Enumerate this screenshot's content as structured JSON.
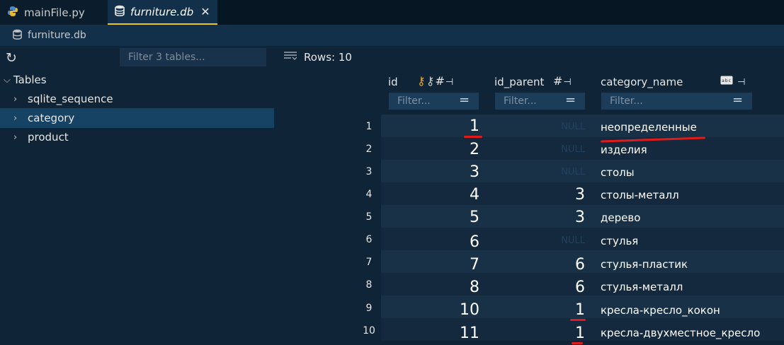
{
  "tabs": [
    {
      "label": "mainFile.py",
      "icon": "python-icon"
    },
    {
      "label": "furniture.db",
      "icon": "database-icon",
      "close": "✕"
    }
  ],
  "breadcrumb": {
    "label": "furniture.db",
    "icon": "database-icon"
  },
  "sidebar": {
    "filter_placeholder": "Filter 3 tables...",
    "root_label": "Tables",
    "items": [
      {
        "label": "sqlite_sequence"
      },
      {
        "label": "category"
      },
      {
        "label": "product"
      }
    ]
  },
  "grid": {
    "rows_label": "Rows: 10",
    "columns": [
      {
        "name": "id",
        "filter_placeholder": "Filter..."
      },
      {
        "name": "id_parent",
        "filter_placeholder": "Filter..."
      },
      {
        "name": "category_name",
        "filter_placeholder": "Filter..."
      }
    ],
    "rows": [
      {
        "num": "1",
        "id": "1",
        "parent": "NULL",
        "name": "неопределенные"
      },
      {
        "num": "2",
        "id": "2",
        "parent": "NULL",
        "name": "изделия"
      },
      {
        "num": "3",
        "id": "3",
        "parent": "NULL",
        "name": "столы"
      },
      {
        "num": "4",
        "id": "4",
        "parent": "3",
        "name": "столы-металл"
      },
      {
        "num": "5",
        "id": "5",
        "parent": "3",
        "name": "дерево"
      },
      {
        "num": "6",
        "id": "6",
        "parent": "NULL",
        "name": "стулья"
      },
      {
        "num": "7",
        "id": "7",
        "parent": "6",
        "name": "стулья-пластик"
      },
      {
        "num": "8",
        "id": "8",
        "parent": "6",
        "name": "стулья-металл"
      },
      {
        "num": "9",
        "id": "10",
        "parent": "1",
        "name": "кресла-кресло_кокон"
      },
      {
        "num": "10",
        "id": "11",
        "parent": "1",
        "name": "кресла-двухместное_кресло"
      }
    ]
  },
  "colors": {
    "accent": "#f0c419",
    "annotation": "#e11b1b",
    "selection": "#164263"
  }
}
